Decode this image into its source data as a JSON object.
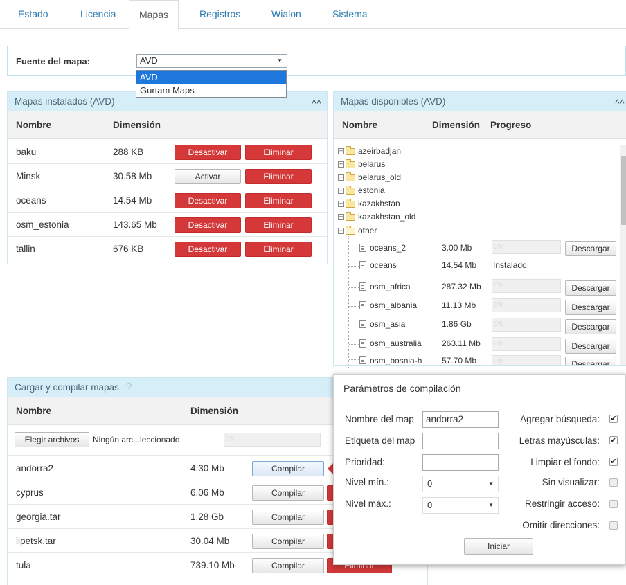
{
  "tabs": [
    {
      "label": "Estado",
      "active": false
    },
    {
      "label": "Licencia",
      "active": false
    },
    {
      "label": "Mapas",
      "active": true
    },
    {
      "label": "Registros",
      "active": false
    },
    {
      "label": "Wialon",
      "active": false
    },
    {
      "label": "Sistema",
      "active": false
    }
  ],
  "source": {
    "label": "Fuente del mapa:",
    "selected": "AVD",
    "options": [
      "AVD",
      "Gurtam Maps"
    ]
  },
  "installed": {
    "title": "Mapas instalados (AVD)",
    "col_name": "Nombre",
    "col_size": "Dimensión",
    "rows": [
      {
        "name": "baku",
        "size": "288 KB",
        "toggle": "Desactivar",
        "toggle_style": "red",
        "delete": "Eliminar"
      },
      {
        "name": "Minsk",
        "size": "30.58 Mb",
        "toggle": "Activar",
        "toggle_style": "gray",
        "delete": "Eliminar"
      },
      {
        "name": "oceans",
        "size": "14.54 Mb",
        "toggle": "Desactivar",
        "toggle_style": "red",
        "delete": "Eliminar"
      },
      {
        "name": "osm_estonia",
        "size": "143.65 Mb",
        "toggle": "Desactivar",
        "toggle_style": "red",
        "delete": "Eliminar"
      },
      {
        "name": "tallin",
        "size": "676 KB",
        "toggle": "Desactivar",
        "toggle_style": "red",
        "delete": "Eliminar"
      }
    ]
  },
  "available": {
    "title": "Mapas disponibles (AVD)",
    "col_name": "Nombre",
    "col_size": "Dimensión",
    "col_progress": "Progreso",
    "folders": [
      "azeirbadjan",
      "belarus",
      "belarus_old",
      "estonia",
      "kazakhstan",
      "kazakhstan_old"
    ],
    "open_folder": "other",
    "files": [
      {
        "name": "oceans_2",
        "size": "3.00 Mb",
        "status": "",
        "progress": "0%",
        "action": "Descargar"
      },
      {
        "name": "oceans",
        "size": "14.54 Mb",
        "status": "Instalado",
        "progress": "",
        "action": ""
      },
      {
        "name": "osm_africa",
        "size": "287.32 Mb",
        "status": "",
        "progress": "0%",
        "action": "Descargar"
      },
      {
        "name": "osm_albania",
        "size": "11.13 Mb",
        "status": "",
        "progress": "0%",
        "action": "Descargar"
      },
      {
        "name": "osm_asia",
        "size": "1.86 Gb",
        "status": "",
        "progress": "0%",
        "action": "Descargar"
      },
      {
        "name": "osm_australia",
        "size": "263.11 Mb",
        "status": "",
        "progress": "0%",
        "action": "Descargar"
      },
      {
        "name": "osm_bosnia-h",
        "size": "57.70 Mb",
        "status": "",
        "progress": "0%",
        "action": "Descargar"
      }
    ]
  },
  "compile": {
    "title": "Cargar y compilar mapas",
    "help": "?",
    "col_name": "Nombre",
    "col_size": "Dimensión",
    "choose_files": "Elegir archivos",
    "no_file": "Ningún arc...leccionado",
    "upload_progress": "0%",
    "rows": [
      {
        "name": "andorra2",
        "size": "4.30 Mb",
        "action": "Compilar",
        "active": true
      },
      {
        "name": "cyprus",
        "size": "6.06 Mb",
        "action": "Compilar",
        "active": false
      },
      {
        "name": "georgia.tar",
        "size": "1.28 Gb",
        "action": "Compilar",
        "active": false
      },
      {
        "name": "lipetsk.tar",
        "size": "30.04 Mb",
        "action": "Compilar",
        "active": false
      },
      {
        "name": "tula",
        "size": "739.10 Mb",
        "action": "Compilar",
        "active": false
      }
    ],
    "delete_label": "Eliminar"
  },
  "params": {
    "title": "Parámetros de compilación",
    "map_name_label": "Nombre del map",
    "map_name_value": "andorra2",
    "map_tag_label": "Etiqueta del map",
    "map_tag_value": "",
    "priority_label": "Prioridad:",
    "priority_value": "",
    "min_level_label": "Nivel mín.:",
    "min_level_value": "0",
    "max_level_label": "Nivel máx.:",
    "max_level_value": "0",
    "options": [
      {
        "label": "Agregar búsqueda:",
        "checked": true
      },
      {
        "label": "Letras mayúsculas:",
        "checked": true
      },
      {
        "label": "Limpiar el fondo:",
        "checked": true
      },
      {
        "label": "Sin visualizar:",
        "checked": false
      },
      {
        "label": "Restringir acceso:",
        "checked": false
      },
      {
        "label": "Omitir direcciones:",
        "checked": false
      }
    ],
    "start_button": "Iniciar"
  },
  "colors": {
    "link": "#2a7ab0",
    "panel_header": "#d6eef8",
    "danger": "#d43838",
    "selected_option": "#1e77dd"
  }
}
